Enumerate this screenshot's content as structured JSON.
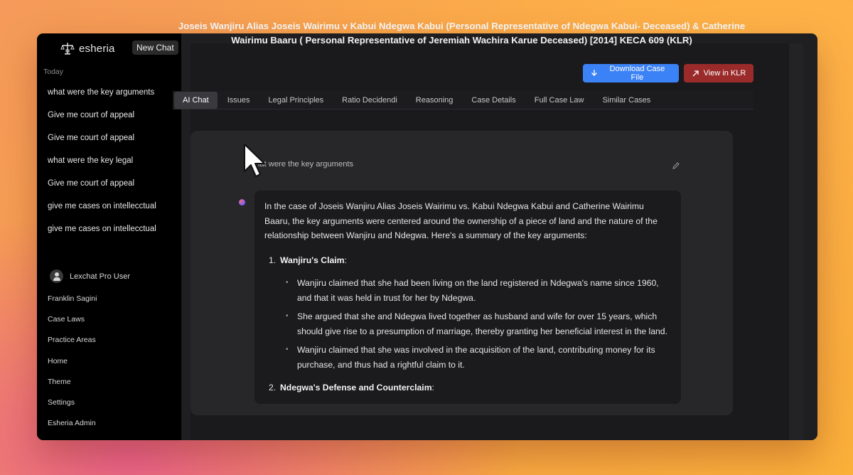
{
  "sidebar": {
    "brand": "esheria",
    "new_chat_label": "New Chat",
    "today_label": "Today",
    "history": [
      "what were the key arguments",
      "Give me court of appeal",
      "Give me court of appeal",
      "what were the key legal",
      "Give me court of appeal",
      "give me cases on intellecctual",
      "give me cases on intellecctual"
    ],
    "user_name": "Lexchat Pro User",
    "menu": [
      "Franklin Sagini",
      "Case Laws",
      "Practice Areas",
      "Home",
      "Theme",
      "Settings",
      "Esheria Admin"
    ]
  },
  "main": {
    "case_title": "Joseis Wanjiru Alias Joseis Wairimu v Kabui Ndegwa Kabui (Personal Representative of Ndegwa Kabui- Deceased) & Catherine Wairimu Baaru ( Personal Representative of Jeremiah Wachira Karue Deceased) [2014] KECA 609 (KLR)",
    "download_label": "Download Case File",
    "view_label": "View in KLR",
    "tabs": [
      "AI Chat",
      "Issues",
      "Legal Principles",
      "Ratio Decidendi",
      "Reasoning",
      "Case Details",
      "Full Case Law",
      "Similar Cases"
    ],
    "active_tab": "AI Chat",
    "user_message": "what were the key arguments",
    "answer": {
      "intro": "In the case of Joseis Wanjiru Alias Joseis Wairimu vs. Kabui Ndegwa Kabui and Catherine Wairimu Baaru, the key arguments were centered around the ownership of a piece of land and the nature of the relationship between Wanjiru and Ndegwa. Here's a summary of the key arguments:",
      "points": [
        {
          "num": "1.",
          "title": "Wanjiru's Claim",
          "bullets": [
            "Wanjiru claimed that she had been living on the land registered in Ndegwa's name since 1960, and that it was held in trust for her by Ndegwa.",
            "She argued that she and Ndegwa lived together as husband and wife for over 15 years, which should give rise to a presumption of marriage, thereby granting her beneficial interest in the land.",
            "Wanjiru claimed that she was involved in the acquisition of the land, contributing money for its purchase, and thus had a rightful claim to it."
          ]
        },
        {
          "num": "2.",
          "title": "Ndegwa's Defense and Counterclaim",
          "bullets": []
        }
      ]
    }
  },
  "colors": {
    "download_button": "#3b82f6",
    "view_button": "#9b2b2b",
    "active_tab": "#3a3a3e"
  }
}
